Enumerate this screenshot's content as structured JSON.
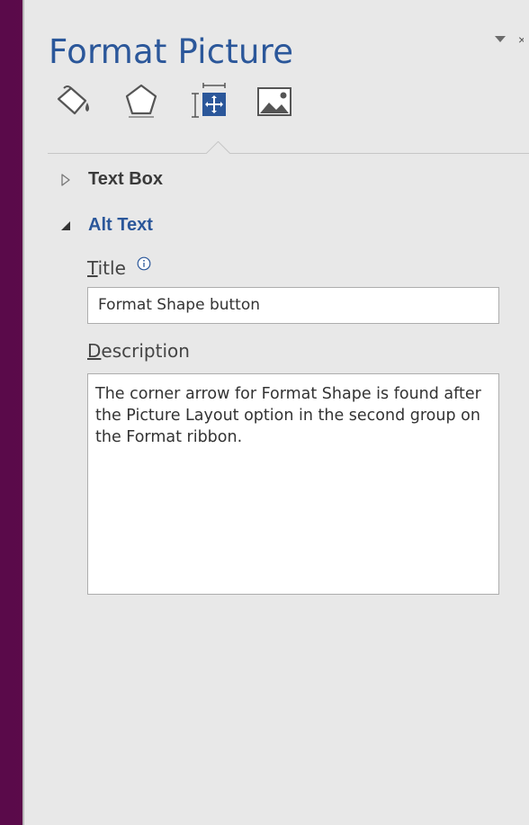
{
  "pane": {
    "title": "Format Picture",
    "menu_icon": "chevron-down-icon",
    "close_icon": "close-icon",
    "close_glyph": "×"
  },
  "tabs": [
    {
      "name": "fill-line",
      "icon": "paint-bucket-icon",
      "selected": false
    },
    {
      "name": "effects",
      "icon": "pentagon-icon",
      "selected": false
    },
    {
      "name": "size-properties",
      "icon": "size-position-icon",
      "selected": true
    },
    {
      "name": "picture",
      "icon": "picture-icon",
      "selected": false
    }
  ],
  "sections": {
    "text_box": {
      "label": "Text Box",
      "expanded": false
    },
    "alt_text": {
      "label": "Alt Text",
      "expanded": true
    }
  },
  "alt_text": {
    "title_label_accesskey": "T",
    "title_label_rest": "itle",
    "title_value": "Format Shape button",
    "description_label_accesskey": "D",
    "description_label_rest": "escription",
    "description_value": "The corner arrow for Format Shape is found after the Picture Layout option in the second group on the Format ribbon."
  },
  "colors": {
    "accent": "#2b579a",
    "pane_bg": "#e8e8e8",
    "desktop_bg": "#5a0a4a"
  }
}
